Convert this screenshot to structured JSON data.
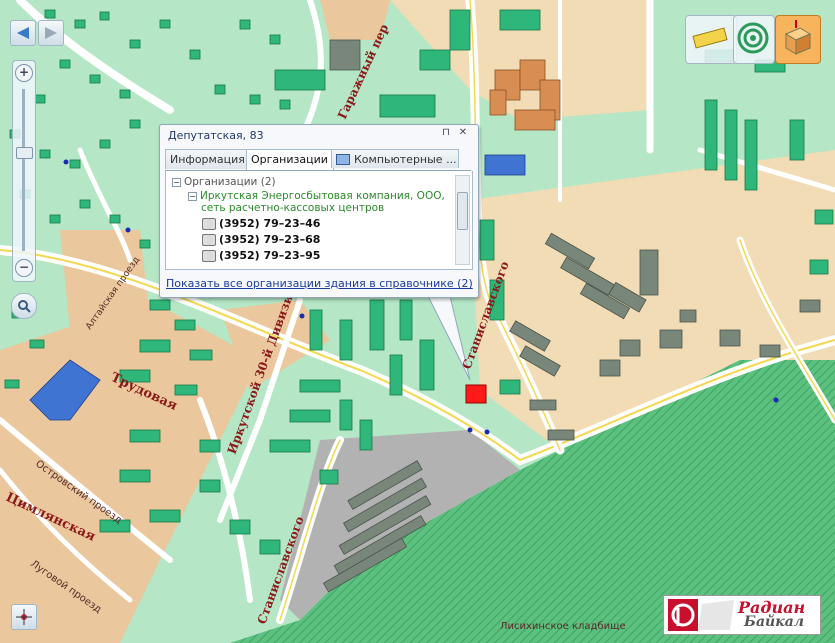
{
  "map": {
    "streets": {
      "garazhny": "Гаражный пер",
      "stanislavskogo_top": "Станиславского",
      "irkutskoy_divizii": "Иркутской 30-й Дивизии",
      "trudovaya": "Трудовая",
      "tsimlyanskaya": "Цимлянская",
      "ostrovsky": "Островский проезд",
      "lugovoy": "Луговой проезд",
      "stanislavskogo_bottom": "Станиславского",
      "altaisky": "Алтайская проезд",
      "kladbishe": "Лисихинское кладбище"
    },
    "accent_colors": {
      "green_block": "#b5e6c6",
      "road": "#ffffff",
      "building": "#2fb67a",
      "selected_building": "#ff1a1a",
      "cemetery": "#4db877"
    }
  },
  "popup": {
    "title": "Депутатская, 83",
    "tabs": [
      {
        "label": "Информация"
      },
      {
        "label": "Организации"
      },
      {
        "label": "Компьютерные ..."
      }
    ],
    "tree": {
      "root_label": "Организации (2)",
      "org_name_line1": "Иркутская Энергосбытовая компания, ООО,",
      "org_name_line2": "сеть расчетно-кассовых центров",
      "phones": [
        "(3952) 79–23–46",
        "(3952) 79–23–68",
        "(3952) 79–23–95"
      ]
    },
    "link_text": "Показать все организации здания в справочнике",
    "link_count": "(2)"
  },
  "logo": {
    "line1": "Радиан",
    "line2": "Байкал"
  }
}
